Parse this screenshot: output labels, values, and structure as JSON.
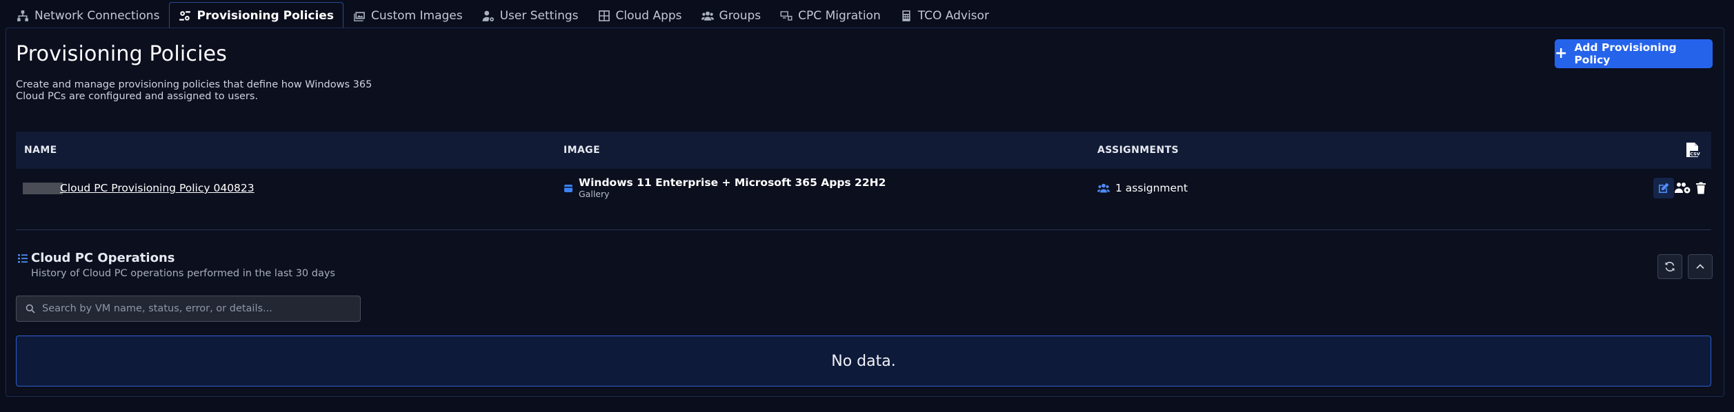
{
  "tabs": [
    {
      "label": "Network Connections",
      "icon": "network-icon",
      "active": false
    },
    {
      "label": "Provisioning Policies",
      "icon": "policy-icon",
      "active": true
    },
    {
      "label": "Custom Images",
      "icon": "images-icon",
      "active": false
    },
    {
      "label": "User Settings",
      "icon": "user-settings-icon",
      "active": false
    },
    {
      "label": "Cloud Apps",
      "icon": "grid-icon",
      "active": false
    },
    {
      "label": "Groups",
      "icon": "groups-icon",
      "active": false
    },
    {
      "label": "CPC Migration",
      "icon": "migration-icon",
      "active": false
    },
    {
      "label": "TCO Advisor",
      "icon": "calculator-icon",
      "active": false
    }
  ],
  "header": {
    "title": "Provisioning Policies",
    "description": "Create and manage provisioning policies that define how Windows 365 Cloud PCs are configured and assigned to users.",
    "add_button_label": "Add Provisioning Policy"
  },
  "table": {
    "columns": [
      "NAME",
      "IMAGE",
      "ASSIGNMENTS"
    ],
    "export_icon": "csv-export-icon",
    "rows": [
      {
        "name": "Cloud PC Provisioning Policy 040823",
        "image_name": "Windows 11 Enterprise + Microsoft 365 Apps 22H2",
        "image_type": "Gallery",
        "assignments": "1 assignment"
      }
    ]
  },
  "operations": {
    "title": "Cloud PC Operations",
    "subtitle": "History of Cloud PC operations performed in the last 30 days",
    "search_placeholder": "Search by VM name, status, error, or details...",
    "empty_text": "No data."
  },
  "colors": {
    "background": "#0a0e1c",
    "accent": "#2563eb",
    "table_header": "#111b36",
    "active_tab_border": "#2a4a8e"
  }
}
